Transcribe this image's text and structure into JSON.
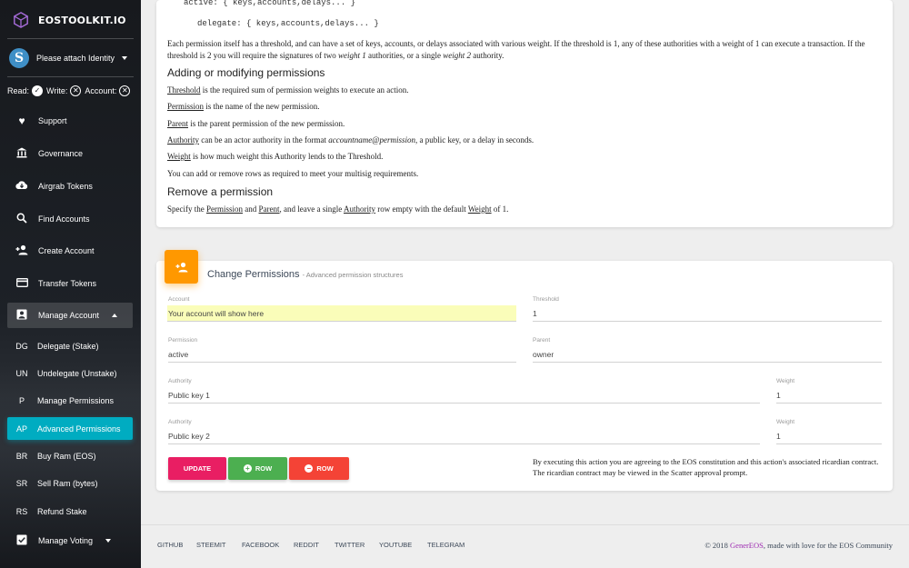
{
  "app": {
    "title": "EOSTOOLKIT.IO"
  },
  "sidebar": {
    "identity": "Please attach Identity",
    "permissions": {
      "read_label": "Read:",
      "write_label": "Write:",
      "account_label": "Account:"
    },
    "items": [
      {
        "label": "Support",
        "icon": "heart-icon"
      },
      {
        "label": "Governance",
        "icon": "bank-icon"
      },
      {
        "label": "Airgrab Tokens",
        "icon": "cloud-download-icon"
      },
      {
        "label": "Find Accounts",
        "icon": "search-icon"
      },
      {
        "label": "Create Account",
        "icon": "person-add-icon"
      },
      {
        "label": "Transfer Tokens",
        "icon": "credit-card-icon"
      },
      {
        "label": "Manage Account",
        "icon": "account-box-icon"
      },
      {
        "label": "Manage Voting",
        "icon": "check-box-icon"
      }
    ],
    "sub_items": [
      {
        "abbr": "DG",
        "label": "Delegate (Stake)"
      },
      {
        "abbr": "UN",
        "label": "Undelegate (Unstake)"
      },
      {
        "abbr": "P",
        "label": "Manage Permissions"
      },
      {
        "abbr": "AP",
        "label": "Advanced Permissions"
      },
      {
        "abbr": "BR",
        "label": "Buy Ram (EOS)"
      },
      {
        "abbr": "SR",
        "label": "Sell Ram (bytes)"
      },
      {
        "abbr": "RS",
        "label": "Refund Stake"
      }
    ]
  },
  "docs": {
    "code_line1": "active: { keys,accounts,delays... }",
    "code_line2": "delegate: { keys,accounts,delays... }",
    "intro_a": "Each permission itself has a threshold, and can have a set of keys, accounts, or delays associated with various weight. If the threshold is 1, any of these authorities with a weight of 1 can execute a transaction. If the threshold is 2 you will require the signatures of two ",
    "intro_em1": "weight 1",
    "intro_b": " authorities, or a single ",
    "intro_em2": "weight 2",
    "intro_c": " authority.",
    "heading_add": "Adding or modifying permissions",
    "threshold_term": "Threshold",
    "threshold_text": " is the required sum of permission weights to execute an action.",
    "permission_term": "Permission",
    "permission_text": " is the name of the new permission.",
    "parent_term": "Parent",
    "parent_text": " is the parent permission of the new permission.",
    "authority_term": "Authority",
    "authority_text_a": " can be an actor authority in the format ",
    "authority_em": "accountname@permission",
    "authority_text_b": ", a public key, or a delay in seconds.",
    "weight_term": "Weight",
    "weight_text": " is how much weight this Authority lends to the Threshold.",
    "rows_text": "You can add or remove rows as required to meet your multisig requirements.",
    "heading_remove": "Remove a permission",
    "remove_a": "Specify the ",
    "remove_perm": "Permission",
    "remove_and": " and ",
    "remove_parent": "Parent",
    "remove_b": ", and leave a single ",
    "remove_auth": "Authority",
    "remove_c": " row empty with the default ",
    "remove_weight": "Weight",
    "remove_d": " of 1."
  },
  "form": {
    "title": "Change Permissions",
    "subtitle": "- Advanced permission structures",
    "account": {
      "label": "Account",
      "value": "Your account will show here"
    },
    "threshold": {
      "label": "Threshold",
      "value": "1"
    },
    "permission": {
      "label": "Permission",
      "value": "active"
    },
    "parent": {
      "label": "Parent",
      "value": "owner"
    },
    "rows": [
      {
        "authority_label": "Authority",
        "authority_value": "Public key 1",
        "weight_label": "Weight",
        "weight_value": "1"
      },
      {
        "authority_label": "Authority",
        "authority_value": "Public key 2",
        "weight_label": "Weight",
        "weight_value": "1"
      }
    ],
    "buttons": {
      "update": "UPDATE",
      "add_row": "ROW",
      "remove_row": "ROW"
    },
    "agreement": "By executing this action you are agreeing to the EOS constitution and this action's associated ricardian contract. The ricardian contract may be viewed in the Scatter approval prompt."
  },
  "footer": {
    "links": [
      "GITHUB",
      "STEEMIT",
      "FACEBOOK",
      "REDDIT",
      "TWITTER",
      "YOUTUBE",
      "TELEGRAM"
    ],
    "copyright_a": "© 2018 ",
    "brand": "GenerEOS",
    "copyright_b": ", made with love for the EOS Community"
  },
  "colors": {
    "accent": "#00acc1",
    "orange": "#ff9800",
    "update": "#e91e63",
    "add": "#4caf50",
    "remove": "#f44336",
    "brand": "#9c27b0"
  }
}
